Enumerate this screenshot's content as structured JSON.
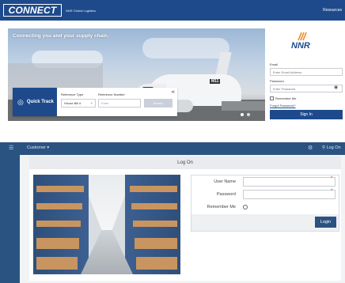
{
  "connect_header": {
    "logo": "CONNECT",
    "tagline": "NNR Global Logistics",
    "resources": "Resources"
  },
  "hero": {
    "heading": "Connecting you and your supply chain.",
    "gate_sign": "M11"
  },
  "quick_track": {
    "label": "Quick Track",
    "reference_type_label": "Reference Type",
    "reference_type_value": "House Bill #",
    "reference_number_label": "Reference Number",
    "reference_number_placeholder": "Enter",
    "search_label": "Search"
  },
  "sign_in": {
    "brand": "NNR",
    "email_label": "Email",
    "email_placeholder": "Enter Email Address",
    "password_label": "Password",
    "password_placeholder": "Enter Password",
    "remember_label": "Remember Me",
    "forgot_link": "Forgot Password?",
    "button": "Sign In"
  },
  "logon_page": {
    "nav": {
      "customer_menu": "Customer ▾",
      "logon_link": "Log On"
    },
    "title": "Log On",
    "username_label": "User Name",
    "password_label": "Password",
    "remember_label": "Remember Me",
    "required_mark": "*",
    "login_button": "Login"
  },
  "colors": {
    "brand_blue": "#1e4a8c",
    "nav_blue": "#2b5382",
    "required_red": "#d0382f"
  },
  "icons": [
    "quick-track-icon",
    "share-icon",
    "eye-icon",
    "menu-icon",
    "gear-icon",
    "user-icon",
    "chevron-down-icon"
  ]
}
